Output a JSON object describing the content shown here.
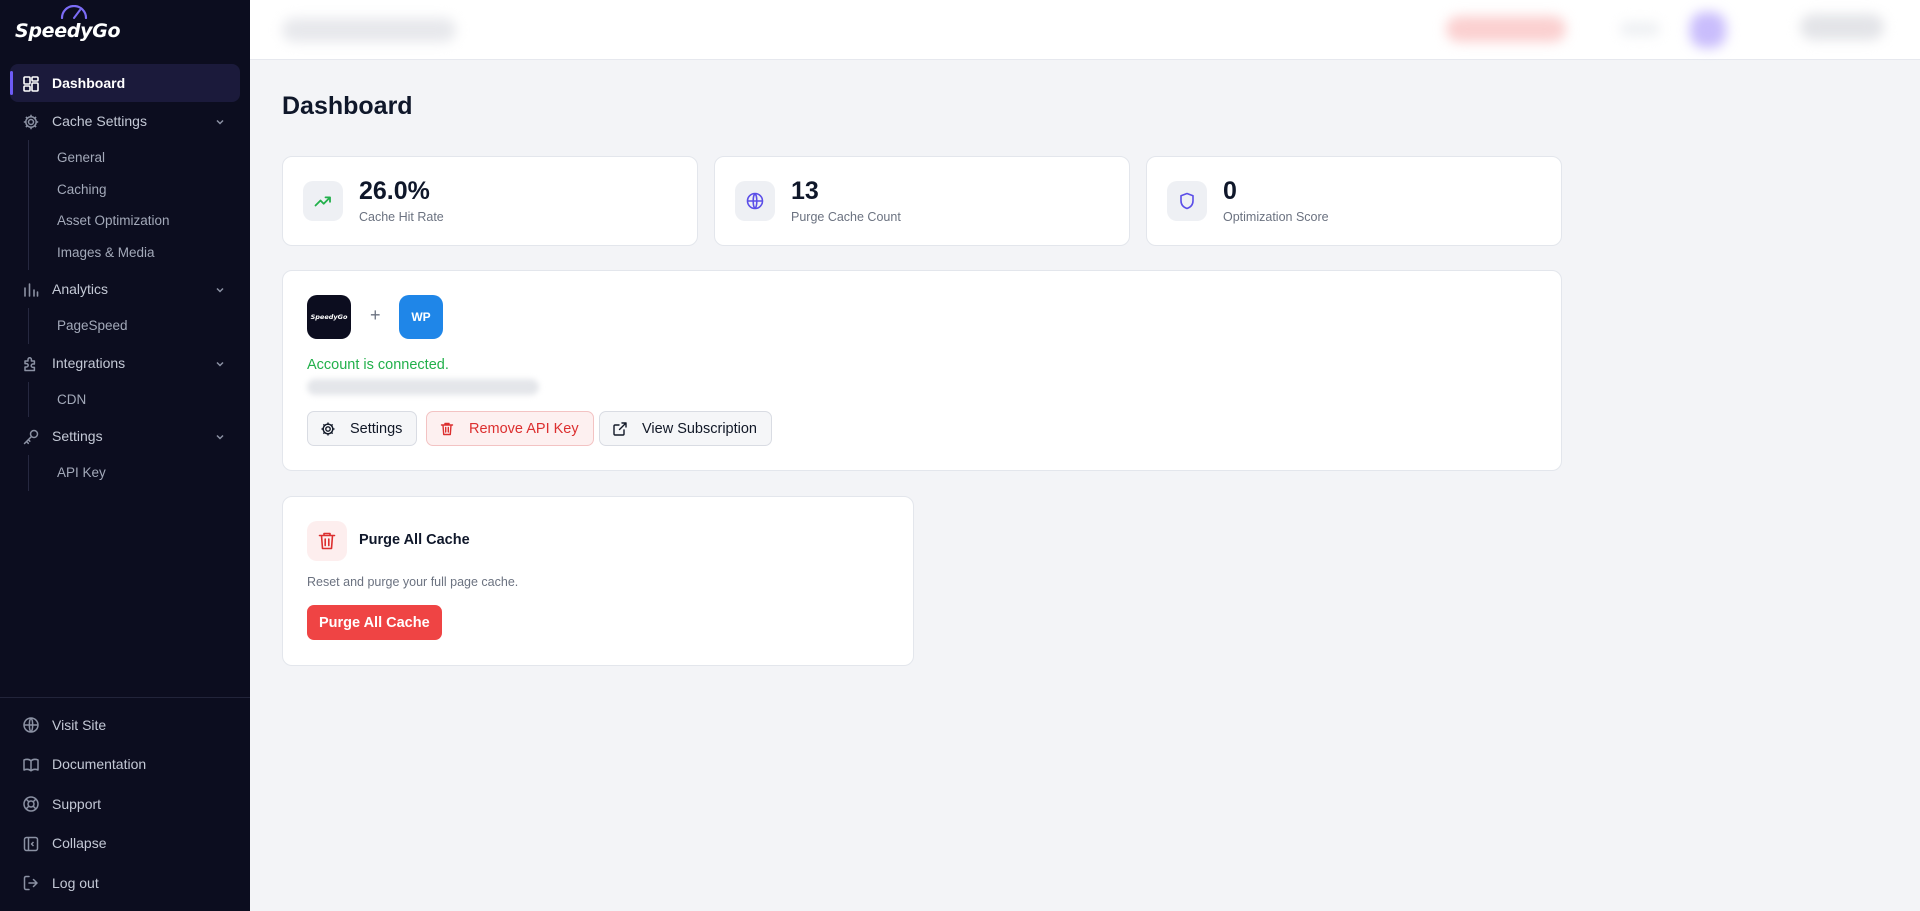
{
  "app": {
    "logo_text": "SpeedyGo"
  },
  "colors": {
    "sidebar_bg": "#0c0d1f",
    "accent": "#6d5bf5",
    "success": "#22b04b",
    "danger": "#ef4444",
    "wp_blue": "#1f86e8"
  },
  "sidebar": {
    "active": "Dashboard",
    "items": [
      {
        "label": "Dashboard",
        "icon": "dashboard-icon"
      },
      {
        "label": "Cache Settings",
        "icon": "gear-icon",
        "children": [
          "General",
          "Caching",
          "Asset Optimization",
          "Images & Media"
        ]
      },
      {
        "label": "Analytics",
        "icon": "bar-chart-icon",
        "children": [
          "PageSpeed"
        ]
      },
      {
        "label": "Integrations",
        "icon": "puzzle-icon",
        "children": [
          "CDN"
        ]
      },
      {
        "label": "Settings",
        "icon": "key-icon",
        "children": [
          "API Key"
        ]
      }
    ],
    "bottom": [
      {
        "label": "Visit Site",
        "icon": "globe-icon"
      },
      {
        "label": "Documentation",
        "icon": "book-icon"
      },
      {
        "label": "Support",
        "icon": "lifebuoy-icon"
      },
      {
        "label": "Collapse",
        "icon": "collapse-icon"
      },
      {
        "label": "Log out",
        "icon": "logout-icon"
      }
    ]
  },
  "main": {
    "title": "Dashboard",
    "stats": [
      {
        "value": "26.0%",
        "label": "Cache Hit Rate",
        "icon": "trending-up-icon"
      },
      {
        "value": "13",
        "label": "Purge Cache Count",
        "icon": "globe-icon"
      },
      {
        "value": "0",
        "label": "Optimization Score",
        "icon": "shield-icon"
      }
    ],
    "connection": {
      "speedygo_badge": "SpeedyGo",
      "plus": "+",
      "wp_badge": "WP",
      "status": "Account is connected.",
      "buttons": {
        "settings": "Settings",
        "remove_api_key": "Remove API Key",
        "view_subscription": "View Subscription"
      }
    },
    "purge": {
      "title": "Purge All Cache",
      "description": "Reset and purge your full page cache.",
      "button": "Purge All Cache"
    }
  }
}
